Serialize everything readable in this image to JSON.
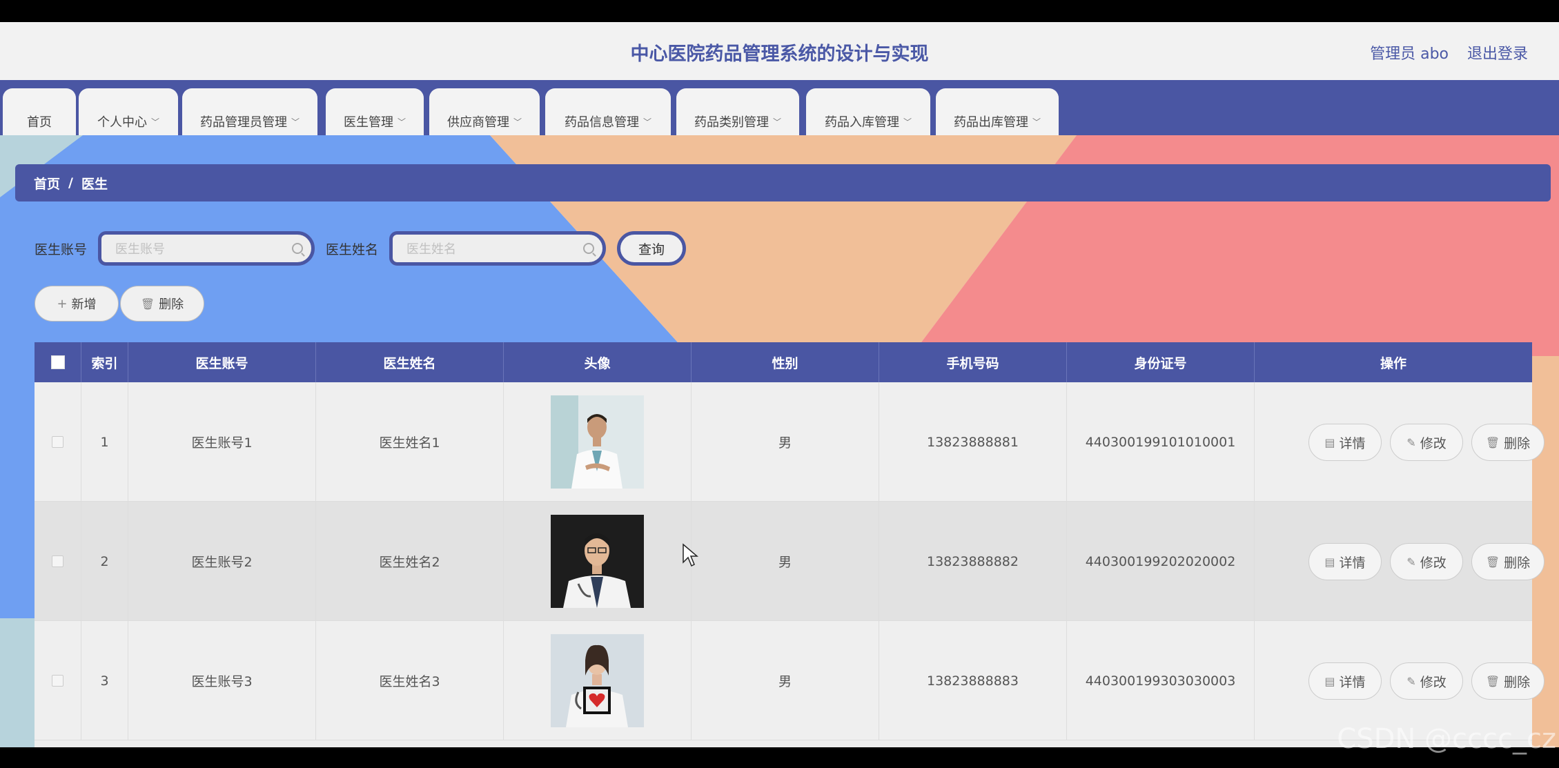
{
  "header": {
    "title": "中心医院药品管理系统的设计与实现",
    "user": "管理员 abo",
    "logout": "退出登录"
  },
  "nav": [
    {
      "label": "首页",
      "has_arrow": false
    },
    {
      "label": "个人中心",
      "has_arrow": true
    },
    {
      "label": "药品管理员管理",
      "has_arrow": true
    },
    {
      "label": "医生管理",
      "has_arrow": true
    },
    {
      "label": "供应商管理",
      "has_arrow": true
    },
    {
      "label": "药品信息管理",
      "has_arrow": true
    },
    {
      "label": "药品类别管理",
      "has_arrow": true
    },
    {
      "label": "药品入库管理",
      "has_arrow": true
    },
    {
      "label": "药品出库管理",
      "has_arrow": true
    }
  ],
  "breadcrumb": {
    "home": "首页",
    "sep": "/",
    "current": "医生"
  },
  "search": {
    "account_label": "医生账号",
    "account_placeholder": "医生账号",
    "name_label": "医生姓名",
    "name_placeholder": "医生姓名",
    "query": "查询"
  },
  "actions": {
    "add": "新增",
    "delete": "删除"
  },
  "table": {
    "headers": [
      "索引",
      "医生账号",
      "医生姓名",
      "头像",
      "性别",
      "手机号码",
      "身份证号",
      "操作"
    ],
    "rows": [
      {
        "index": "1",
        "account": "医生账号1",
        "name": "医生姓名1",
        "gender": "男",
        "phone": "13823888881",
        "id": "440300199101010001"
      },
      {
        "index": "2",
        "account": "医生账号2",
        "name": "医生姓名2",
        "gender": "男",
        "phone": "13823888882",
        "id": "440300199202020002"
      },
      {
        "index": "3",
        "account": "医生账号3",
        "name": "医生姓名3",
        "gender": "男",
        "phone": "13823888883",
        "id": "440300199303030003"
      }
    ],
    "ops": {
      "detail": "详情",
      "edit": "修改",
      "delete": "删除"
    }
  },
  "watermark": "CSDN @cccc_cz",
  "colors": {
    "primary": "#4a56a3",
    "bg_blue": "#6f9ff2",
    "bg_peach": "#f1bf98",
    "bg_pink": "#f48b8d"
  }
}
